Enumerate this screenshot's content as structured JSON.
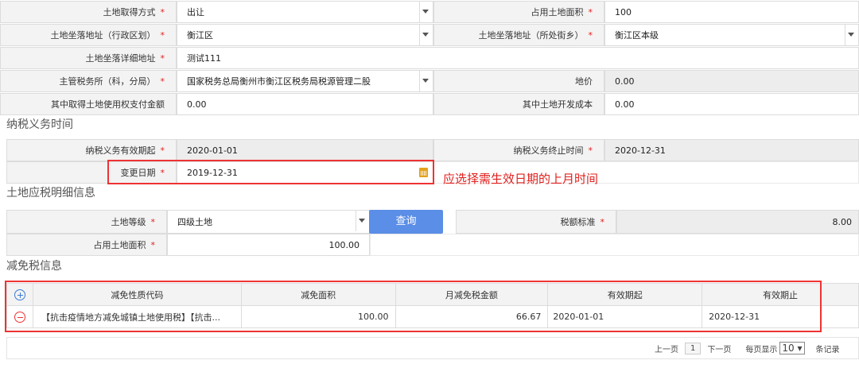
{
  "form": {
    "acquire_method": {
      "label": "土地取得方式",
      "value": "出让"
    },
    "land_area": {
      "label": "占用土地面积",
      "value": "100"
    },
    "district": {
      "label": "土地坐落地址（行政区划）",
      "value": "衡江区"
    },
    "street": {
      "label": "土地坐落地址（所处街乡）",
      "value": "衡江区本级"
    },
    "detail_address": {
      "label": "土地坐落详细地址",
      "value": "测试111"
    },
    "tax_office": {
      "label": "主管税务所（科，分局）",
      "value": "国家税务总局衡州市衡江区税务局税源管理二股"
    },
    "land_price": {
      "label": "地价",
      "value": "0.00"
    },
    "land_use_right_fee": {
      "label": "其中取得土地使用权支付金额",
      "value": "0.00"
    },
    "land_dev_cost": {
      "label": "其中土地开发成本",
      "value": "0.00"
    }
  },
  "tax_period": {
    "title": "纳税义务时间",
    "start": {
      "label": "纳税义务有效期起",
      "value": "2020-01-01"
    },
    "end": {
      "label": "纳税义务终止时间",
      "value": "2020-12-31"
    },
    "change_date": {
      "label": "变更日期",
      "value": "2019-12-31"
    },
    "annotation": "应选择需生效日期的上月时间"
  },
  "land_tax_detail": {
    "title": "土地应税明细信息",
    "grade": {
      "label": "土地等级",
      "value": "四级土地"
    },
    "query_button": "查询",
    "tax_standard": {
      "label": "税额标准",
      "value": "8.00"
    },
    "area": {
      "label": "占用土地面积",
      "value": "100.00"
    }
  },
  "exemption": {
    "title": "减免税信息",
    "columns": [
      "减免性质代码",
      "减免面积",
      "月减免税金额",
      "有效期起",
      "有效期止"
    ],
    "rows": [
      {
        "code": "【抗击疫情地方减免城镇土地使用税】【抗击...",
        "area": "100.00",
        "monthly": "66.67",
        "start": "2020-01-01",
        "end": "2020-12-31"
      }
    ]
  },
  "pager": {
    "prev": "上一页",
    "page": "1",
    "next": "下一页",
    "per_page_label": "每页显示",
    "per_page_value": "10",
    "records_suffix": "条记录"
  },
  "required_mark": "*",
  "colors": {
    "required": "#e0201e",
    "accent": "#5b8ee6",
    "highlight_box": "#e33"
  }
}
